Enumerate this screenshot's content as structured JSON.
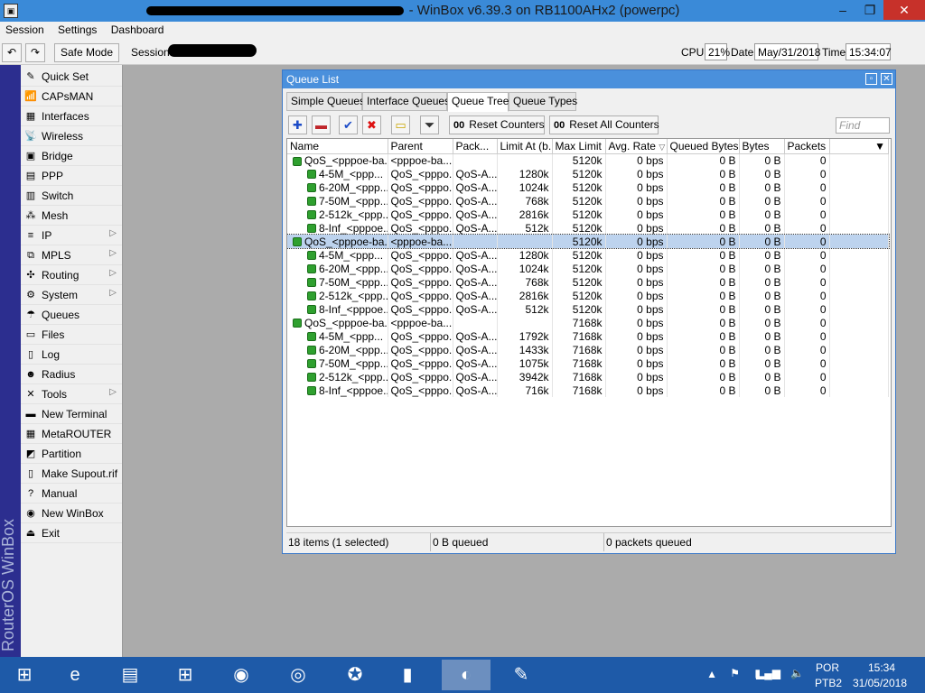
{
  "titlebar": {
    "title": "- WinBox v6.39.3 on RB1100AHx2 (powerpc)",
    "min": "–",
    "max": "❐",
    "close": "✕"
  },
  "menubar": {
    "items": [
      "Session",
      "Settings",
      "Dashboard"
    ]
  },
  "toolbar": {
    "undo": "↶",
    "redo": "↷",
    "safe_mode": "Safe Mode",
    "session_label": "Session:",
    "cpu_label": "CPU:",
    "cpu_value": "21%",
    "date_label": "Date:",
    "date_value": "May/31/2018",
    "time_label": "Time:",
    "time_value": "15:34:07"
  },
  "brand": {
    "text": "RouterOS WinBox"
  },
  "sidebar": {
    "items": [
      {
        "label": "Quick Set",
        "icon": "quick-set-icon",
        "glyph": "✎",
        "arrow": false
      },
      {
        "label": "CAPsMAN",
        "icon": "capsman-icon",
        "glyph": "📶",
        "arrow": false
      },
      {
        "label": "Interfaces",
        "icon": "interfaces-icon",
        "glyph": "▦",
        "arrow": false
      },
      {
        "label": "Wireless",
        "icon": "wireless-icon",
        "glyph": "📡",
        "arrow": false
      },
      {
        "label": "Bridge",
        "icon": "bridge-icon",
        "glyph": "▣",
        "arrow": false
      },
      {
        "label": "PPP",
        "icon": "ppp-icon",
        "glyph": "▤",
        "arrow": false
      },
      {
        "label": "Switch",
        "icon": "switch-icon",
        "glyph": "▥",
        "arrow": false
      },
      {
        "label": "Mesh",
        "icon": "mesh-icon",
        "glyph": "⁂",
        "arrow": false
      },
      {
        "label": "IP",
        "icon": "ip-icon",
        "glyph": "≡",
        "arrow": true
      },
      {
        "label": "MPLS",
        "icon": "mpls-icon",
        "glyph": "⧉",
        "arrow": true
      },
      {
        "label": "Routing",
        "icon": "routing-icon",
        "glyph": "✣",
        "arrow": true
      },
      {
        "label": "System",
        "icon": "system-icon",
        "glyph": "⚙",
        "arrow": true
      },
      {
        "label": "Queues",
        "icon": "queues-icon",
        "glyph": "☂",
        "arrow": false
      },
      {
        "label": "Files",
        "icon": "files-icon",
        "glyph": "▭",
        "arrow": false
      },
      {
        "label": "Log",
        "icon": "log-icon",
        "glyph": "▯",
        "arrow": false
      },
      {
        "label": "Radius",
        "icon": "radius-icon",
        "glyph": "☻",
        "arrow": false
      },
      {
        "label": "Tools",
        "icon": "tools-icon",
        "glyph": "✕",
        "arrow": true
      },
      {
        "label": "New Terminal",
        "icon": "terminal-icon",
        "glyph": "▬",
        "arrow": false
      },
      {
        "label": "MetaROUTER",
        "icon": "metarouter-icon",
        "glyph": "▦",
        "arrow": false
      },
      {
        "label": "Partition",
        "icon": "partition-icon",
        "glyph": "◩",
        "arrow": false
      },
      {
        "label": "Make Supout.rif",
        "icon": "supout-icon",
        "glyph": "▯",
        "arrow": false
      },
      {
        "label": "Manual",
        "icon": "manual-icon",
        "glyph": "?",
        "arrow": false
      },
      {
        "label": "New WinBox",
        "icon": "winbox-icon",
        "glyph": "◉",
        "arrow": false
      },
      {
        "label": "Exit",
        "icon": "exit-icon",
        "glyph": "⏏",
        "arrow": false
      }
    ]
  },
  "queue_window": {
    "title": "Queue List",
    "tabs": [
      "Simple Queues",
      "Interface Queues",
      "Queue Tree",
      "Queue Types"
    ],
    "active_tab": "Queue Tree",
    "reset_counters": "Reset Counters",
    "reset_all_counters": "Reset All Counters",
    "oo": "00",
    "find_placeholder": "Find",
    "columns": [
      "Name",
      "Parent",
      "Pack...",
      "Limit At (b...",
      "Max Limit ...",
      "Avg. Rate",
      "Queued Bytes",
      "Bytes",
      "Packets"
    ],
    "rows": [
      {
        "name": "QoS_<pppoe-ba...",
        "parent": "<pppoe-ba...",
        "pack": "",
        "limit_at": "",
        "max_limit": "5120k",
        "avg_rate": "0 bps",
        "queued": "0 B",
        "bytes": "0 B",
        "packets": "0",
        "level": 0,
        "selected": false
      },
      {
        "name": "4-5M_<ppp...",
        "parent": "QoS_<pppo...",
        "pack": "QoS-A...",
        "limit_at": "1280k",
        "max_limit": "5120k",
        "avg_rate": "0 bps",
        "queued": "0 B",
        "bytes": "0 B",
        "packets": "0",
        "level": 1,
        "selected": false
      },
      {
        "name": "6-20M_<ppp...",
        "parent": "QoS_<pppo...",
        "pack": "QoS-A...",
        "limit_at": "1024k",
        "max_limit": "5120k",
        "avg_rate": "0 bps",
        "queued": "0 B",
        "bytes": "0 B",
        "packets": "0",
        "level": 1,
        "selected": false
      },
      {
        "name": "7-50M_<ppp...",
        "parent": "QoS_<pppo...",
        "pack": "QoS-A...",
        "limit_at": "768k",
        "max_limit": "5120k",
        "avg_rate": "0 bps",
        "queued": "0 B",
        "bytes": "0 B",
        "packets": "0",
        "level": 1,
        "selected": false
      },
      {
        "name": "2-512k_<ppp...",
        "parent": "QoS_<pppo...",
        "pack": "QoS-A...",
        "limit_at": "2816k",
        "max_limit": "5120k",
        "avg_rate": "0 bps",
        "queued": "0 B",
        "bytes": "0 B",
        "packets": "0",
        "level": 1,
        "selected": false
      },
      {
        "name": "8-Inf_<pppoe...",
        "parent": "QoS_<pppo...",
        "pack": "QoS-A...",
        "limit_at": "512k",
        "max_limit": "5120k",
        "avg_rate": "0 bps",
        "queued": "0 B",
        "bytes": "0 B",
        "packets": "0",
        "level": 1,
        "selected": false
      },
      {
        "name": "QoS_<pppoe-ba...",
        "parent": "<pppoe-ba...",
        "pack": "",
        "limit_at": "",
        "max_limit": "5120k",
        "avg_rate": "0 bps",
        "queued": "0 B",
        "bytes": "0 B",
        "packets": "0",
        "level": 0,
        "selected": true
      },
      {
        "name": "4-5M_<ppp...",
        "parent": "QoS_<pppo...",
        "pack": "QoS-A...",
        "limit_at": "1280k",
        "max_limit": "5120k",
        "avg_rate": "0 bps",
        "queued": "0 B",
        "bytes": "0 B",
        "packets": "0",
        "level": 1,
        "selected": false
      },
      {
        "name": "6-20M_<ppp...",
        "parent": "QoS_<pppo...",
        "pack": "QoS-A...",
        "limit_at": "1024k",
        "max_limit": "5120k",
        "avg_rate": "0 bps",
        "queued": "0 B",
        "bytes": "0 B",
        "packets": "0",
        "level": 1,
        "selected": false
      },
      {
        "name": "7-50M_<ppp...",
        "parent": "QoS_<pppo...",
        "pack": "QoS-A...",
        "limit_at": "768k",
        "max_limit": "5120k",
        "avg_rate": "0 bps",
        "queued": "0 B",
        "bytes": "0 B",
        "packets": "0",
        "level": 1,
        "selected": false
      },
      {
        "name": "2-512k_<ppp...",
        "parent": "QoS_<pppo...",
        "pack": "QoS-A...",
        "limit_at": "2816k",
        "max_limit": "5120k",
        "avg_rate": "0 bps",
        "queued": "0 B",
        "bytes": "0 B",
        "packets": "0",
        "level": 1,
        "selected": false
      },
      {
        "name": "8-Inf_<pppoe...",
        "parent": "QoS_<pppo...",
        "pack": "QoS-A...",
        "limit_at": "512k",
        "max_limit": "5120k",
        "avg_rate": "0 bps",
        "queued": "0 B",
        "bytes": "0 B",
        "packets": "0",
        "level": 1,
        "selected": false
      },
      {
        "name": "QoS_<pppoe-ba...",
        "parent": "<pppoe-ba...",
        "pack": "",
        "limit_at": "",
        "max_limit": "7168k",
        "avg_rate": "0 bps",
        "queued": "0 B",
        "bytes": "0 B",
        "packets": "0",
        "level": 0,
        "selected": false
      },
      {
        "name": "4-5M_<ppp...",
        "parent": "QoS_<pppo...",
        "pack": "QoS-A...",
        "limit_at": "1792k",
        "max_limit": "7168k",
        "avg_rate": "0 bps",
        "queued": "0 B",
        "bytes": "0 B",
        "packets": "0",
        "level": 1,
        "selected": false
      },
      {
        "name": "6-20M_<ppp...",
        "parent": "QoS_<pppo...",
        "pack": "QoS-A...",
        "limit_at": "1433k",
        "max_limit": "7168k",
        "avg_rate": "0 bps",
        "queued": "0 B",
        "bytes": "0 B",
        "packets": "0",
        "level": 1,
        "selected": false
      },
      {
        "name": "7-50M_<ppp...",
        "parent": "QoS_<pppo...",
        "pack": "QoS-A...",
        "limit_at": "1075k",
        "max_limit": "7168k",
        "avg_rate": "0 bps",
        "queued": "0 B",
        "bytes": "0 B",
        "packets": "0",
        "level": 1,
        "selected": false
      },
      {
        "name": "2-512k_<ppp...",
        "parent": "QoS_<pppo...",
        "pack": "QoS-A...",
        "limit_at": "3942k",
        "max_limit": "7168k",
        "avg_rate": "0 bps",
        "queued": "0 B",
        "bytes": "0 B",
        "packets": "0",
        "level": 1,
        "selected": false
      },
      {
        "name": "8-Inf_<pppoe...",
        "parent": "QoS_<pppo...",
        "pack": "QoS-A...",
        "limit_at": "716k",
        "max_limit": "7168k",
        "avg_rate": "0 bps",
        "queued": "0 B",
        "bytes": "0 B",
        "packets": "0",
        "level": 1,
        "selected": false
      }
    ],
    "status": {
      "items": "18 items (1 selected)",
      "queued": "0 B queued",
      "packets": "0 packets queued"
    }
  },
  "taskbar": {
    "apps": [
      {
        "name": "start-icon",
        "glyph": "⊞",
        "active": false
      },
      {
        "name": "ie-icon",
        "glyph": "e",
        "active": false
      },
      {
        "name": "explorer-icon",
        "glyph": "▤",
        "active": false
      },
      {
        "name": "store-icon",
        "glyph": "⊞",
        "active": false
      },
      {
        "name": "firefox-icon",
        "glyph": "◉",
        "active": false
      },
      {
        "name": "chrome-icon",
        "glyph": "◎",
        "active": false
      },
      {
        "name": "app-red-icon",
        "glyph": "✪",
        "active": false
      },
      {
        "name": "cmd-icon",
        "glyph": "▮",
        "active": false
      },
      {
        "name": "winbox-task-icon",
        "glyph": "◐",
        "active": true
      },
      {
        "name": "paint-icon",
        "glyph": "✎",
        "active": false
      }
    ],
    "lang": "POR",
    "layout": "PTB2",
    "time": "15:34",
    "date": "31/05/2018"
  }
}
